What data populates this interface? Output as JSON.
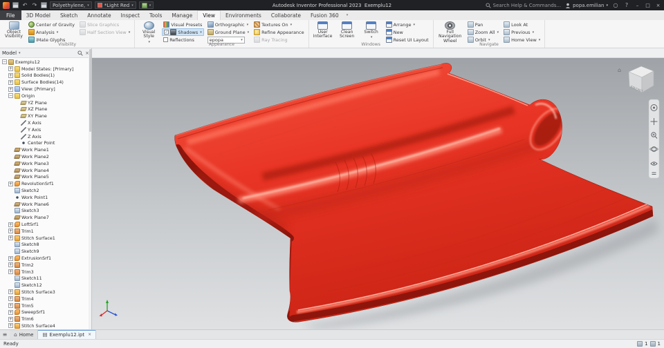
{
  "titlebar": {
    "qat_material": "Polyethylene,",
    "qat_appearance": "*Light Red",
    "app_title": "Autodesk Inventor Professional 2023",
    "doc_name": "Exemplu12",
    "search_placeholder": "Search Help & Commands...",
    "user_name": "popa.emilian"
  },
  "ribbon": {
    "file_tab": "File",
    "active_tab": "View",
    "tabs": [
      "3D Model",
      "Sketch",
      "Annotate",
      "Inspect",
      "Tools",
      "Manage",
      "View",
      "Environments",
      "Collaborate",
      "Fusion 360"
    ],
    "groups": [
      {
        "label": "Visibility",
        "bigs": [
          {
            "label": "Object Visibility",
            "lines": [
              "Object",
              "Visibility"
            ],
            "icon": "object-visibility",
            "ic": "eye"
          }
        ],
        "cols": [
          [
            {
              "label": "Center of Gravity",
              "icon": "center-of-gravity",
              "ic": "cog"
            },
            {
              "label": "Analysis",
              "icon": "analysis",
              "ic": "analysis",
              "arrow": true
            },
            {
              "label": "iMate Glyphs",
              "icon": "imate-glyphs",
              "ic": "imate"
            }
          ],
          [
            {
              "label": "Slice Graphics",
              "icon": "slice-graphics",
              "ic": "gray",
              "disabled": true
            },
            {
              "label": "Half Section View",
              "icon": "half-section-view",
              "ic": "gray",
              "arrow": true,
              "disabled": true
            }
          ]
        ]
      },
      {
        "label": "Appearance",
        "bigs": [
          {
            "label": "Visual Style",
            "lines": [
              "Visual",
              "Style"
            ],
            "icon": "visual-style",
            "ic": "sphere",
            "arrow": true
          }
        ],
        "cols": [
          [
            {
              "label": "Visual Presets",
              "icon": "visual-presets",
              "ic": "multi"
            },
            {
              "label": "Shadows",
              "icon": "shadows",
              "ic": "shadow",
              "arrow": true,
              "check": true,
              "on": true
            },
            {
              "label": "Reflections",
              "icon": "reflections",
              "ic": "none",
              "check": false
            }
          ],
          [
            {
              "label": "Orthographic",
              "icon": "orthographic",
              "ic": "cube",
              "arrow": true
            },
            {
              "label": "Ground Plane",
              "icon": "ground-plane",
              "ic": "plane",
              "arrow": true
            },
            {
              "label": "epopa",
              "icon": "appearance-style",
              "combo": true
            }
          ],
          [
            {
              "label": "Textures On",
              "icon": "textures-on",
              "ic": "texture",
              "arrow": true
            },
            {
              "label": "Refine Appearance",
              "icon": "refine-appearance",
              "ic": "refine"
            },
            {
              "label": "Ray Tracing",
              "icon": "ray-tracing",
              "ic": "gray",
              "disabled": true
            }
          ]
        ]
      },
      {
        "label": "Windows",
        "bigs": [
          {
            "label": "User Interface",
            "lines": [
              "User",
              "Interface"
            ],
            "icon": "user-interface",
            "ic": "window"
          },
          {
            "label": "Clean Screen",
            "lines": [
              "Clean",
              "Screen"
            ],
            "icon": "clean-screen",
            "ic": "window"
          },
          {
            "label": "Switch",
            "lines": [
              "Switch"
            ],
            "icon": "switch-windows",
            "ic": "window",
            "arrow": true
          }
        ],
        "cols": [
          [
            {
              "label": "Arrange",
              "icon": "arrange",
              "ic": "window",
              "arrow": true
            },
            {
              "label": "New",
              "icon": "new-window",
              "ic": "window"
            },
            {
              "label": "Reset UI Layout",
              "icon": "reset-ui-layout",
              "ic": "window"
            }
          ]
        ]
      },
      {
        "label": "Navigate",
        "bigs": [
          {
            "label": "Full Navigation Wheel",
            "lines": [
              "Full",
              "Navigation",
              "Wheel"
            ],
            "icon": "full-navigation-wheel",
            "ic": "wheel",
            "wide": true
          }
        ],
        "cols": [
          [
            {
              "label": "Pan",
              "icon": "pan",
              "ic": "nav"
            },
            {
              "label": "Zoom All",
              "icon": "zoom-all",
              "ic": "nav",
              "arrow": true
            },
            {
              "label": "Orbit",
              "icon": "orbit",
              "ic": "nav",
              "arrow": true
            }
          ],
          [
            {
              "label": "Look At",
              "icon": "look-at",
              "ic": "nav"
            },
            {
              "label": "Previous",
              "icon": "previous",
              "ic": "nav",
              "arrow": true
            },
            {
              "label": "Home View",
              "icon": "home-view",
              "ic": "nav",
              "arrow": true
            }
          ]
        ]
      }
    ]
  },
  "browser": {
    "title": "Model",
    "items": [
      {
        "label": "Exemplu12",
        "lvl": 0,
        "exp": "-",
        "ic": "part"
      },
      {
        "label": "Model States: [Primary]",
        "lvl": 1,
        "exp": "+",
        "ic": "folder"
      },
      {
        "label": "Solid Bodies(1)",
        "lvl": 1,
        "exp": "+",
        "ic": "folder"
      },
      {
        "label": "Surface Bodies(14)",
        "lvl": 1,
        "exp": "+",
        "ic": "folder"
      },
      {
        "label": "View: [Primary]",
        "lvl": 1,
        "exp": "+",
        "ic": "view"
      },
      {
        "label": "Origin",
        "lvl": 1,
        "exp": "-",
        "ic": "folder"
      },
      {
        "label": "YZ Plane",
        "lvl": 2,
        "ic": "plane"
      },
      {
        "label": "XZ Plane",
        "lvl": 2,
        "ic": "plane"
      },
      {
        "label": "XY Plane",
        "lvl": 2,
        "ic": "plane"
      },
      {
        "label": "X Axis",
        "lvl": 2,
        "ic": "axis"
      },
      {
        "label": "Y Axis",
        "lvl": 2,
        "ic": "axis"
      },
      {
        "label": "Z Axis",
        "lvl": 2,
        "ic": "axis"
      },
      {
        "label": "Center Point",
        "lvl": 2,
        "ic": "point"
      },
      {
        "label": "Work Plane1",
        "lvl": 1,
        "ic": "workplane"
      },
      {
        "label": "Work Plane2",
        "lvl": 1,
        "ic": "workplane"
      },
      {
        "label": "Work Plane3",
        "lvl": 1,
        "ic": "workplane"
      },
      {
        "label": "Work Plane4",
        "lvl": 1,
        "ic": "workplane"
      },
      {
        "label": "Work Plane5",
        "lvl": 1,
        "ic": "workplane"
      },
      {
        "label": "RevolutionSrf1",
        "lvl": 1,
        "exp": "+",
        "ic": "surf"
      },
      {
        "label": "Sketch2",
        "lvl": 1,
        "ic": "sketch"
      },
      {
        "label": "Work Point1",
        "lvl": 1,
        "ic": "point"
      },
      {
        "label": "Work Plane6",
        "lvl": 1,
        "ic": "workplane"
      },
      {
        "label": "Sketch3",
        "lvl": 1,
        "ic": "sketch"
      },
      {
        "label": "Work Plane7",
        "lvl": 1,
        "ic": "workplane"
      },
      {
        "label": "LoftSrf1",
        "lvl": 1,
        "exp": "+",
        "ic": "surf"
      },
      {
        "label": "Trim1",
        "lvl": 1,
        "exp": "+",
        "ic": "trim"
      },
      {
        "label": "Stitch Surface1",
        "lvl": 1,
        "exp": "+",
        "ic": "stitch"
      },
      {
        "label": "Sketch8",
        "lvl": 1,
        "ic": "sketch"
      },
      {
        "label": "Sketch9",
        "lvl": 1,
        "ic": "sketch"
      },
      {
        "label": "ExtrusionSrf1",
        "lvl": 1,
        "exp": "+",
        "ic": "surf"
      },
      {
        "label": "Trim2",
        "lvl": 1,
        "exp": "+",
        "ic": "trim"
      },
      {
        "label": "Trim3",
        "lvl": 1,
        "exp": "+",
        "ic": "trim"
      },
      {
        "label": "Sketch11",
        "lvl": 1,
        "ic": "sketch"
      },
      {
        "label": "Sketch12",
        "lvl": 1,
        "ic": "sketch"
      },
      {
        "label": "Stitch Surface3",
        "lvl": 1,
        "exp": "+",
        "ic": "stitch"
      },
      {
        "label": "Trim4",
        "lvl": 1,
        "exp": "+",
        "ic": "trim"
      },
      {
        "label": "Trim5",
        "lvl": 1,
        "exp": "+",
        "ic": "trim"
      },
      {
        "label": "SweepSrf1",
        "lvl": 1,
        "exp": "+",
        "ic": "surf"
      },
      {
        "label": "Trim6",
        "lvl": 1,
        "exp": "+",
        "ic": "trim"
      },
      {
        "label": "Stitch Surface4",
        "lvl": 1,
        "exp": "+",
        "ic": "stitch"
      }
    ]
  },
  "viewport": {
    "viewcube_label": "FRONT",
    "model_color": "#e83425"
  },
  "doc_tabs": [
    {
      "label": "Home",
      "icon": "home",
      "active": false,
      "closable": false
    },
    {
      "label": "Exemplu12.ipt",
      "icon": "part",
      "active": true,
      "closable": true
    }
  ],
  "statusbar": {
    "message": "Ready",
    "count_a": "1",
    "count_b": "1"
  }
}
